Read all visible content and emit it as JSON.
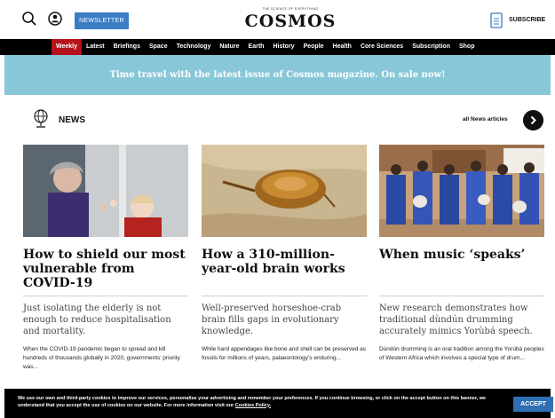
{
  "header": {
    "newsletter_label": "NEWSLETTER",
    "logo_tagline": "THE SCIENCE OF EVERYTHING",
    "logo": "COSMOS",
    "subscribe_label": "SUBSCRIBE",
    "icons": [
      "search-icon",
      "account-icon",
      "magazine-icon"
    ]
  },
  "nav": {
    "items": [
      "Weekly",
      "Latest",
      "Briefings",
      "Space",
      "Technology",
      "Nature",
      "Earth",
      "History",
      "People",
      "Health",
      "Core Sciences",
      "Subscription",
      "Shop"
    ],
    "active": "Weekly"
  },
  "banner": {
    "text": "Time travel with the latest issue of Cosmos magazine. On sale now!"
  },
  "news": {
    "heading": "NEWS",
    "all_label": "all News articles",
    "articles": [
      {
        "title": "How to shield our most vulnerable from COVID-19",
        "subtitle": "Just isolating the elderly is not enough to reduce hospitalisation and mortality.",
        "excerpt": "When the COVID-19 pandemic began to spread and kill hundreds of thousands globally in 2020, governments’ priority was..."
      },
      {
        "title": "How a 310-million-year-old brain works",
        "subtitle": "Well-preserved horseshoe-crab brain fills gaps in evolutionary knowledge.",
        "excerpt": "While hard appendages like bone and shell can be preserved as fossils for millions of years, palaeontology’s enduring..."
      },
      {
        "title": "When music ‘speaks’",
        "subtitle": "New research demonstrates how traditional dùndún drumming accurately mimics Yorùbá speech.",
        "excerpt": "Dùndún drumming is an oral tradition among the Yorùbá peoples of Western Africa which involves a special type of drum..."
      }
    ]
  },
  "cookie": {
    "text": "We use our own and third-party cookies to improve our services, personalise your advertising and remember your preferences. If you continue browsing, or click on the accept button on this banner, we understand that you accept the use of cookies on our website. For more information visit our",
    "link": "Cookies Policy.",
    "accept_label": "ACCEPT"
  },
  "colors": {
    "accent_blue": "#3a7dc4",
    "nav_active": "#b5121b",
    "banner_bg": "#88c7d8",
    "cookie_bg": "#000000"
  }
}
